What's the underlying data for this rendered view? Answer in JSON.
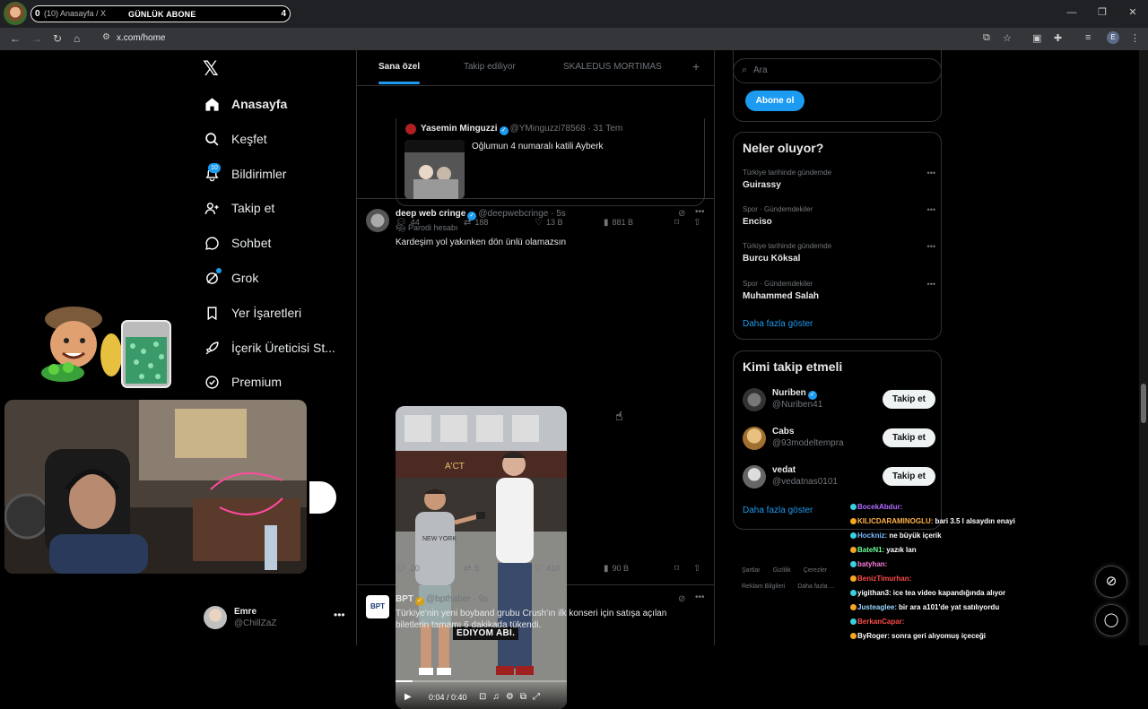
{
  "browser": {
    "tab": {
      "count": "0",
      "title": "(10) Anasayfa / X",
      "overlay_title": "GÜNLÜK ABONE",
      "overlay_number": "4"
    },
    "url": "x.com/home",
    "profile_initial": "E",
    "window_controls": [
      "—",
      "❐",
      "✕"
    ]
  },
  "nav": {
    "items": [
      {
        "name": "home",
        "label": "Anasayfa",
        "icon": "home-icon"
      },
      {
        "name": "explore",
        "label": "Keşfet",
        "icon": "search-icon"
      },
      {
        "name": "notifications",
        "label": "Bildirimler",
        "icon": "bell-icon"
      },
      {
        "name": "follow",
        "label": "Takip et",
        "icon": "add-user-icon"
      },
      {
        "name": "chat",
        "label": "Sohbet",
        "icon": "chat-icon"
      },
      {
        "name": "grok",
        "label": "Grok",
        "icon": "grok-icon"
      },
      {
        "name": "bookmarks",
        "label": "Yer İşaretleri",
        "icon": "bookmark-icon"
      },
      {
        "name": "creator",
        "label": "İçerik Üreticisi St...",
        "icon": "rocket-icon"
      },
      {
        "name": "premium",
        "label": "Premium",
        "icon": "verified-icon"
      }
    ],
    "notifications_badge": "10",
    "account": {
      "name": "Emre",
      "handle": "@ChillZaZ"
    }
  },
  "feed": {
    "tabs": [
      "Sana özel",
      "Takip ediliyor",
      "SKALEDUS MORTIMAS"
    ],
    "tweets": [
      {
        "quote": {
          "name": "Yasemin Minguzzi",
          "meta": "@YMinguzzi78568 · 31 Tem",
          "text": "Oğlumun 4 numaralı katili Ayberk"
        },
        "actions": {
          "replies": "44",
          "reposts": "188",
          "likes": "13 B",
          "views": "881 B"
        }
      },
      {
        "name": "deep web cringe",
        "meta": "@deepwebcringe · 5s",
        "label": "Parodi hesabı",
        "text": "Kardeşim yol yakınken dön ünlü olamazsın",
        "video": {
          "caption": "EDIYOM ABI.",
          "time": "0:04 / 0:40",
          "progress": 0.1
        },
        "actions": {
          "replies": "20",
          "reposts": "5",
          "likes": "410",
          "views": "90 B"
        }
      },
      {
        "name": "BPT",
        "meta": "@bpthaber · 9s",
        "text1": "Türkiye'nin yeni boyband grubu Crush'ın ilk konseri için satışa açılan",
        "text2": "biletlerin tamamı 6 dakikada tükendi."
      }
    ]
  },
  "right": {
    "search_placeholder": "Ara",
    "subscribe_label": "Abone ol",
    "trends_title": "Neler oluyor?",
    "trends": [
      {
        "context": "Türkiye tarihinde gündemde",
        "name": "Guirassy"
      },
      {
        "context": "Spor · Gündemdekiler",
        "name": "Enciso"
      },
      {
        "context": "Türkiye tarihinde gündemde",
        "name": "Burcu Köksal"
      },
      {
        "context": "Spor · Gündemdekiler",
        "name": "Muhammed Salah"
      }
    ],
    "show_more": "Daha fazla göster",
    "who_title": "Kimi takip etmeli",
    "who": [
      {
        "name": "Nuriben",
        "handle": "@Nuriben41",
        "verified": true
      },
      {
        "name": "Cabs",
        "handle": "@93modeltempra",
        "verified": false
      },
      {
        "name": "vedat",
        "handle": "@vedatnas0101",
        "verified": false
      }
    ],
    "follow_label": "Takip et",
    "footer": [
      "Şartlar",
      "Gizlilik",
      "Çerezler",
      "Reklam Bilgileri",
      "Daha fazla ..."
    ]
  },
  "chat": [
    {
      "user": "BocekAbdur:",
      "msg": "",
      "color": "#b06cff"
    },
    {
      "user": "KILICDARAMINOGLU:",
      "msg": "bari 3.5 l alsaydın enayi",
      "color": "#ffb347"
    },
    {
      "user": "Hockniz:",
      "msg": "ne büyük içerik",
      "color": "#7ab8ff"
    },
    {
      "user": "BateN1:",
      "msg": "yazık lan",
      "color": "#6cff9a"
    },
    {
      "user": "batyhan:",
      "msg": "",
      "color": "#ff7adf"
    },
    {
      "user": "BenizTimurhan:",
      "msg": "",
      "color": "#ff4a4a"
    },
    {
      "user": "yigithan3:",
      "msg": "ice tea video kapandığında alıyor",
      "color": "#ffffff"
    },
    {
      "user": "Justeaglee:",
      "msg": "bir ara a101'de yat satılıyordu",
      "color": "#9ad7ff"
    },
    {
      "user": "BerkanCapar:",
      "msg": "",
      "color": "#ff4a4a"
    },
    {
      "user": "ByRoger:",
      "msg": "sonra geri alıyomuş içeceği",
      "color": "#ffffff"
    }
  ],
  "colors": {
    "accent": "#1d9bf0",
    "bg": "#000000",
    "border": "#2f3336",
    "muted": "#71767b"
  }
}
